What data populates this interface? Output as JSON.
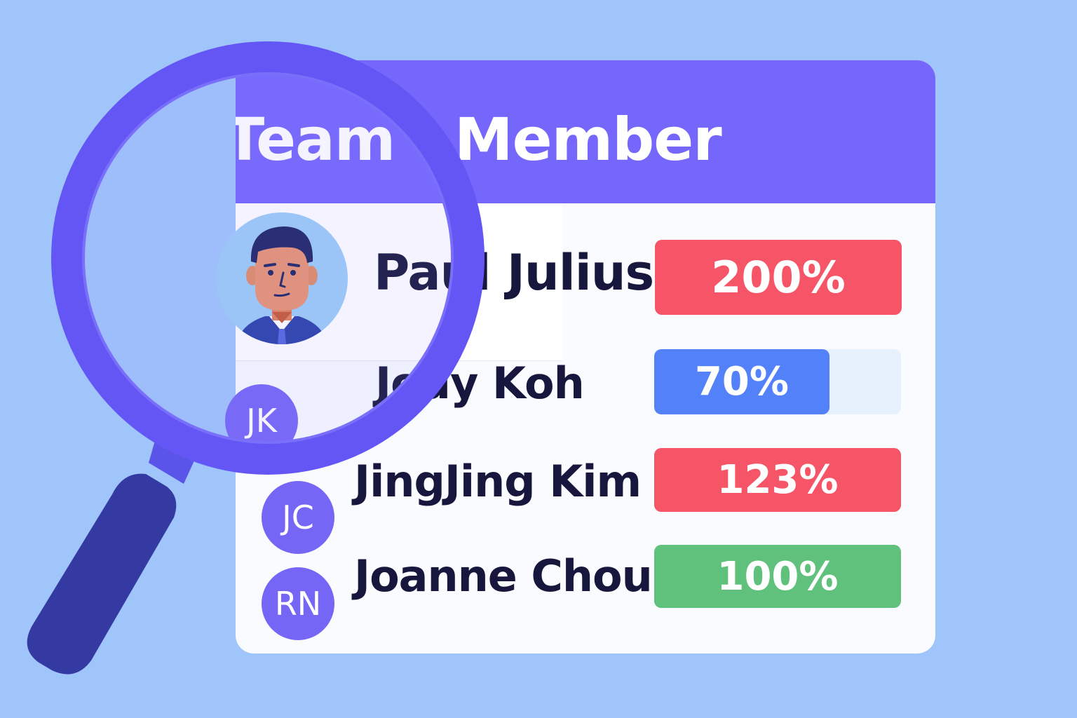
{
  "title": "Team   Member",
  "colors": {
    "background": "#9fc5fb",
    "header": "#7567fc",
    "red": "#f55566",
    "blue": "#5281f9",
    "green": "#5fc17b",
    "track": "#e6f1fd",
    "lens": "#6356f5",
    "handle": "#343aa2"
  },
  "featured": {
    "name": "Paul Julius",
    "icon": "person-avatar-icon",
    "progress": {
      "label": "200%",
      "percent": 200
    }
  },
  "members": [
    {
      "initials": "JK",
      "name": "Jody Koh",
      "progress": {
        "label": "70%",
        "percent": 70
      }
    },
    {
      "initials": "JC",
      "name": "JingJing Kim",
      "progress": {
        "label": "123%",
        "percent": 123
      }
    },
    {
      "initials": "RN",
      "name": "Joanne Chou",
      "progress": {
        "label": "100%",
        "percent": 100
      }
    }
  ],
  "magnifier_icon": "magnifying-glass-icon"
}
